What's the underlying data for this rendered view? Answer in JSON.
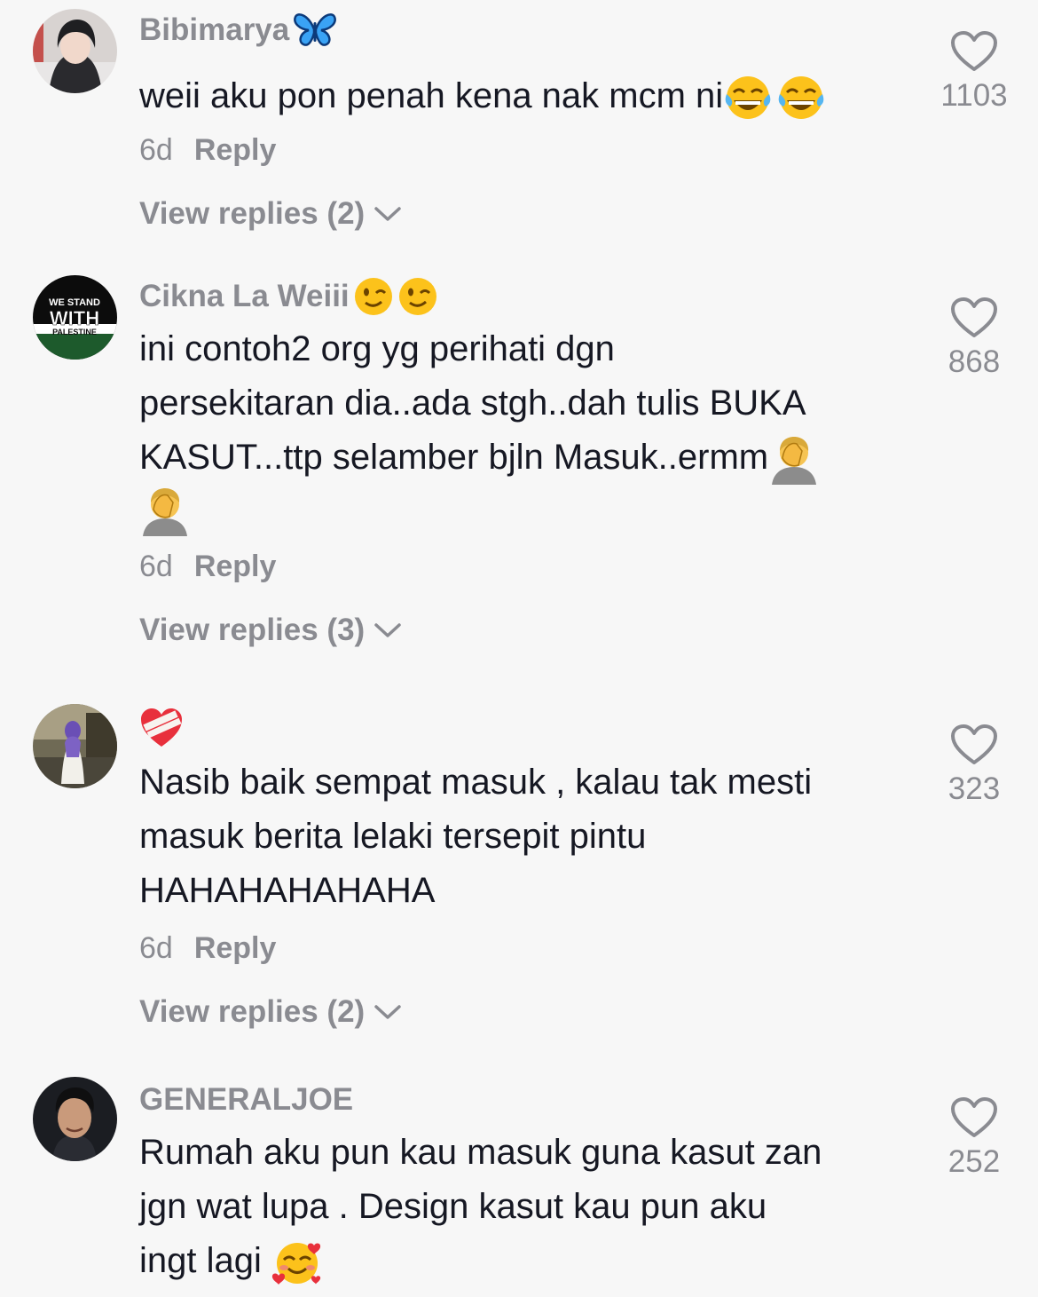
{
  "comments": [
    {
      "username": "Bibimarya",
      "username_emoji": [
        "butterfly-emoji"
      ],
      "text": "weii aku pon penah kena nak mcm ni",
      "text_emoji_after": [
        "tears-of-joy-emoji",
        "tears-of-joy-emoji"
      ],
      "age": "6d",
      "reply_label": "Reply",
      "view_replies": "View replies (2)",
      "likes": "1103"
    },
    {
      "username": "Cikna La Weiii",
      "username_emoji": [
        "winking-face-emoji",
        "winking-face-emoji"
      ],
      "avatar_text": [
        "WE STAND",
        "WITH",
        "PALESTINE"
      ],
      "text_lines": [
        "ini contoh2 org yg perihati dgn",
        "persekitaran dia..ada stgh..dah tulis BUKA",
        "KASUT...ttp selamber bjln Masuk..ermm"
      ],
      "text_emoji_after": [
        "facepalm-emoji"
      ],
      "extra_line_emoji": [
        "facepalm-emoji"
      ],
      "age": "6d",
      "reply_label": "Reply",
      "view_replies": "View replies (3)",
      "likes": "868"
    },
    {
      "username": "",
      "username_emoji": [
        "mending-heart-emoji"
      ],
      "text_lines": [
        "Nasib baik sempat masuk , kalau tak mesti",
        "masuk berita lelaki tersepit pintu",
        "HAHAHAHAHAHA"
      ],
      "age": "6d",
      "reply_label": "Reply",
      "view_replies": "View replies (2)",
      "likes": "323"
    },
    {
      "username": "GENERALJOE",
      "text_lines": [
        "Rumah aku pun kau masuk guna kasut zan",
        "jgn wat lupa . Design kasut kau pun aku",
        "ingt lagi"
      ],
      "text_emoji_after": [
        "smiling-face-with-hearts-emoji"
      ],
      "likes": "252"
    }
  ],
  "colors": {
    "background": "#f7f7f7",
    "text": "#161823",
    "muted": "#8a8b91"
  }
}
